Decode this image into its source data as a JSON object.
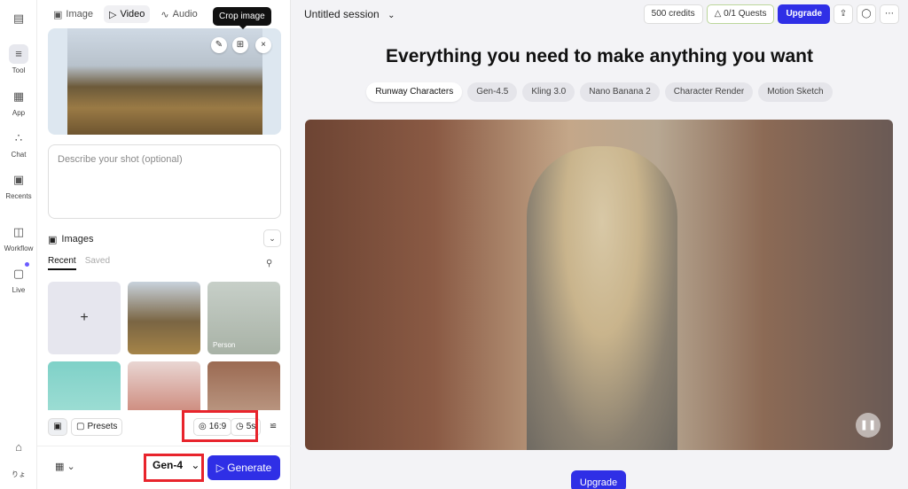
{
  "rail": {
    "items": [
      {
        "label": "",
        "icon": "layout-icon"
      },
      {
        "label": "Tool",
        "icon": "sliders-icon"
      },
      {
        "label": "App",
        "icon": "grid-icon"
      },
      {
        "label": "Chat",
        "icon": "nodes-icon"
      },
      {
        "label": "Recents",
        "icon": "gallery-icon"
      },
      {
        "label": "Workflow",
        "icon": "workflow-icon"
      },
      {
        "label": "Live",
        "icon": "live-icon"
      }
    ],
    "home_icon": "home-icon",
    "footer_text": "りょ"
  },
  "panel": {
    "tabs": [
      {
        "label": "Image"
      },
      {
        "label": "Video"
      },
      {
        "label": "Audio"
      }
    ],
    "tooltip": "Crop image",
    "prompt_placeholder": "Describe your shot (optional)",
    "images_title": "Images",
    "subtabs": [
      {
        "label": "Recent"
      },
      {
        "label": "Saved"
      }
    ],
    "grid_person_label": "Person",
    "presets_label": "Presets",
    "aspect_label": "16:9",
    "duration_label": "5s",
    "model_label": "Gen-4",
    "generate_label": "Generate"
  },
  "main": {
    "session_title": "Untitled session",
    "credits": "500 credits",
    "quests": "0/1 Quests",
    "upgrade": "Upgrade",
    "headline": "Everything you need to make anything you want",
    "chips": [
      "Runway Characters",
      "Gen-4.5",
      "Kling 3.0",
      "Nano Banana 2",
      "Character Render",
      "Motion Sketch"
    ],
    "bottom_upgrade": "Upgrade"
  },
  "colors": {
    "accent": "#2f2fe6",
    "highlight": "#e8242c"
  }
}
